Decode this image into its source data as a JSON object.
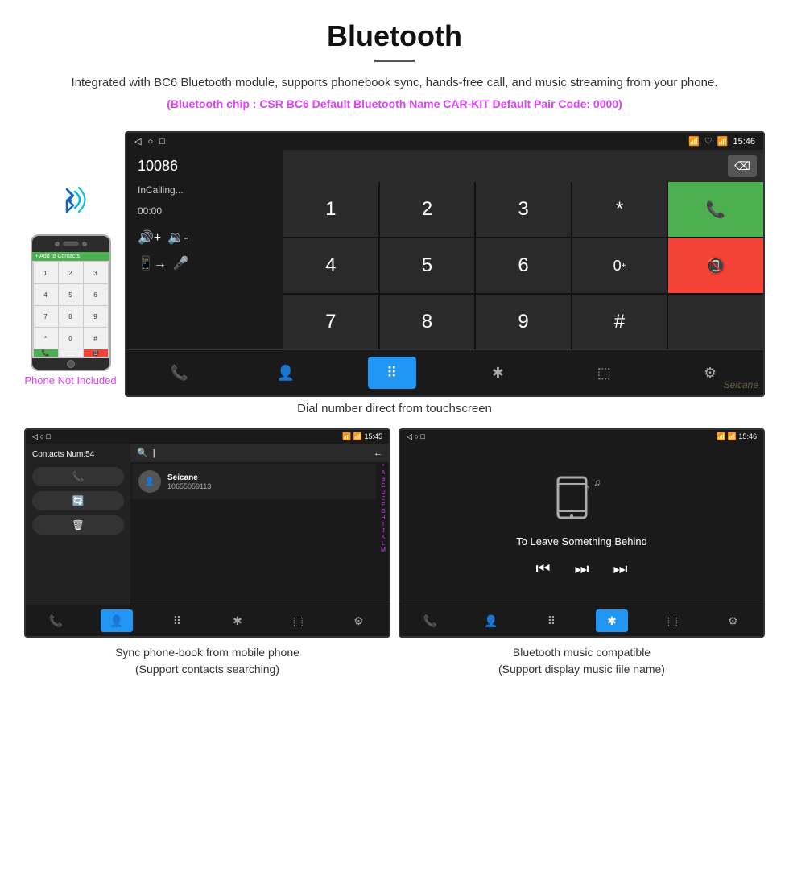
{
  "header": {
    "title": "Bluetooth",
    "description": "Integrated with BC6 Bluetooth module, supports phonebook sync, hands-free call, and music streaming from your phone.",
    "specs": "(Bluetooth chip : CSR BC6    Default Bluetooth Name CAR-KIT    Default Pair Code: 0000)"
  },
  "main_screen": {
    "status_bar": {
      "left_icons": [
        "◁",
        "○",
        "□"
      ],
      "right_icons": [
        "📶",
        "♡",
        "📶"
      ],
      "time": "15:46"
    },
    "dialer": {
      "number": "10086",
      "status": "InCalling...",
      "time_elapsed": "00:00"
    },
    "keypad": {
      "keys": [
        "1",
        "2",
        "3",
        "*",
        "4",
        "5",
        "6",
        "0+",
        "7",
        "8",
        "9",
        "#"
      ]
    },
    "bottom_nav": [
      "☎",
      "👤",
      "⠿",
      "✱",
      "⬚",
      "⚙"
    ]
  },
  "main_caption": "Dial number direct from touchscreen",
  "phone_not_included": "Phone Not Included",
  "bottom_left": {
    "status_bar_time": "15:45",
    "contacts_num": "Contacts Num:54",
    "contact_name": "Seicane",
    "contact_number": "10655059113",
    "caption_line1": "Sync phone-book from mobile phone",
    "caption_line2": "(Support contacts searching)",
    "alphabet": [
      "*",
      "A",
      "B",
      "C",
      "D",
      "E",
      "F",
      "G",
      "H",
      "I",
      "J",
      "K",
      "L",
      "M"
    ]
  },
  "bottom_right": {
    "status_bar_time": "15:46",
    "song_title": "To Leave Something Behind",
    "caption_line1": "Bluetooth music compatible",
    "caption_line2": "(Support display music file name)"
  },
  "icons": {
    "bluetooth": "⚡",
    "phone": "📞",
    "microphone": "🎤",
    "music_note": "🎵",
    "search": "🔍",
    "back": "←",
    "skip_back": "⏮",
    "play_pause": "⏭",
    "skip_fwd": "⏭"
  }
}
